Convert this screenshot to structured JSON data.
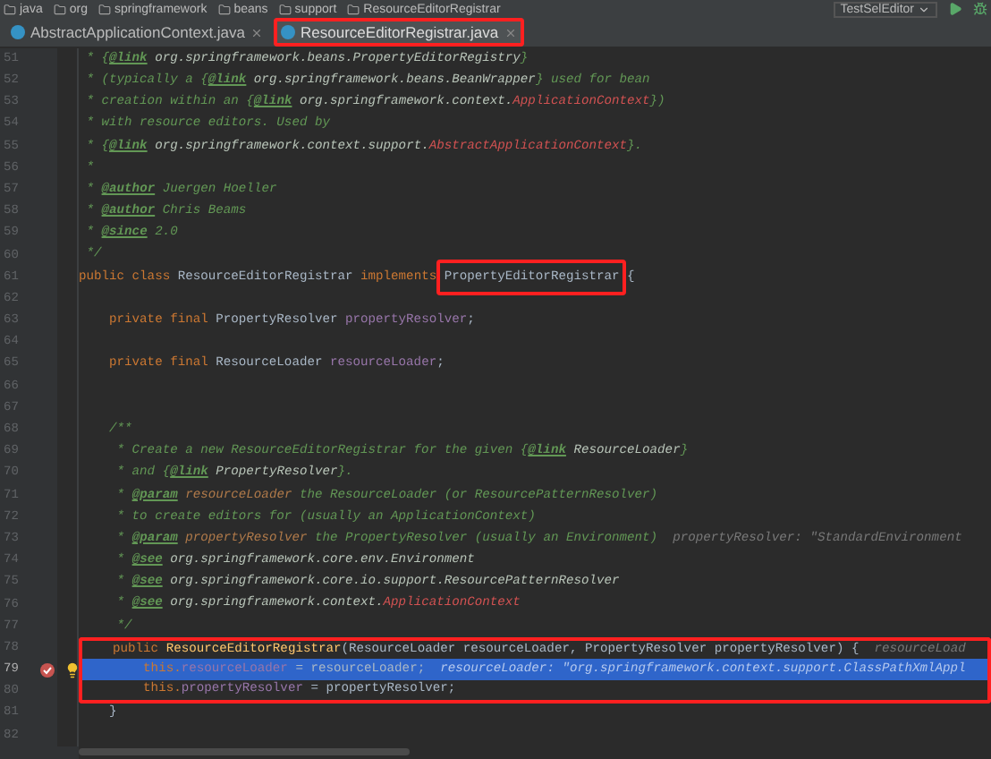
{
  "breadcrumb": {
    "items": [
      "java",
      "org",
      "springframework",
      "beans",
      "support",
      "ResourceEditorRegistrar"
    ],
    "run_config": "TestSelEditor"
  },
  "tabs": [
    {
      "label": "AbstractApplicationContext.java",
      "selected": false,
      "boxed": false
    },
    {
      "label": "ResourceEditorRegistrar.java",
      "selected": true,
      "boxed": true
    }
  ],
  "lines": [
    {
      "number": "51",
      "selected": false,
      "tokens": [
        {
          "kind": "comment",
          "text": " * {"
        },
        {
          "kind": "tag",
          "text": "@link"
        },
        {
          "kind": "ref",
          "text": " org.springframework.beans.PropertyEditorRegistry"
        },
        {
          "kind": "comment",
          "text": "}"
        }
      ]
    },
    {
      "number": "52",
      "selected": false,
      "tokens": [
        {
          "kind": "comment",
          "text": " * (typically a {"
        },
        {
          "kind": "tag",
          "text": "@link"
        },
        {
          "kind": "ref",
          "text": " org.springframework.beans.BeanWrapper"
        },
        {
          "kind": "comment",
          "text": "} used for bean"
        }
      ]
    },
    {
      "number": "53",
      "selected": false,
      "tokens": [
        {
          "kind": "comment",
          "text": " * creation within an {"
        },
        {
          "kind": "tag",
          "text": "@link"
        },
        {
          "kind": "ref",
          "text": " org.springframework.context."
        },
        {
          "kind": "red",
          "text": "ApplicationContext"
        },
        {
          "kind": "comment",
          "text": "})"
        }
      ]
    },
    {
      "number": "54",
      "selected": false,
      "tokens": [
        {
          "kind": "comment",
          "text": " * with resource editors. Used by"
        }
      ]
    },
    {
      "number": "55",
      "selected": false,
      "tokens": [
        {
          "kind": "comment",
          "text": " * {"
        },
        {
          "kind": "tag",
          "text": "@link"
        },
        {
          "kind": "ref",
          "text": " org.springframework.context.support."
        },
        {
          "kind": "red",
          "text": "AbstractApplicationContext"
        },
        {
          "kind": "comment",
          "text": "}."
        }
      ]
    },
    {
      "number": "56",
      "selected": false,
      "tokens": [
        {
          "kind": "comment",
          "text": " *"
        }
      ]
    },
    {
      "number": "57",
      "selected": false,
      "tokens": [
        {
          "kind": "comment",
          "text": " * "
        },
        {
          "kind": "tag",
          "text": "@author"
        },
        {
          "kind": "comment",
          "text": " Juergen Hoeller"
        }
      ]
    },
    {
      "number": "58",
      "selected": false,
      "tokens": [
        {
          "kind": "comment",
          "text": " * "
        },
        {
          "kind": "tag",
          "text": "@author"
        },
        {
          "kind": "comment",
          "text": " Chris Beams"
        }
      ]
    },
    {
      "number": "59",
      "selected": false,
      "tokens": [
        {
          "kind": "comment",
          "text": " * "
        },
        {
          "kind": "tag",
          "text": "@since"
        },
        {
          "kind": "comment",
          "text": " 2.0"
        }
      ]
    },
    {
      "number": "60",
      "selected": false,
      "tokens": [
        {
          "kind": "comment",
          "text": " */"
        }
      ]
    },
    {
      "number": "61",
      "selected": false,
      "tokens": [
        {
          "kind": "keyword",
          "text": "public class "
        },
        {
          "kind": "plain",
          "text": "ResourceEditorRegistrar "
        },
        {
          "kind": "keyword",
          "text": "implements "
        },
        {
          "kind": "boxed",
          "text": "PropertyEditorRegistrar"
        },
        {
          "kind": "plain",
          "text": " {"
        }
      ]
    },
    {
      "number": "62",
      "selected": false
    },
    {
      "number": "63",
      "selected": false,
      "tokens": [
        {
          "kind": "keyword",
          "text": "    private final "
        },
        {
          "kind": "plain",
          "text": "PropertyResolver "
        },
        {
          "kind": "field",
          "text": "propertyResolver"
        },
        {
          "kind": "plain",
          "text": ";"
        }
      ]
    },
    {
      "number": "64",
      "selected": false
    },
    {
      "number": "65",
      "selected": false,
      "tokens": [
        {
          "kind": "keyword",
          "text": "    private final "
        },
        {
          "kind": "plain",
          "text": "ResourceLoader "
        },
        {
          "kind": "field",
          "text": "resourceLoader"
        },
        {
          "kind": "plain",
          "text": ";"
        }
      ]
    },
    {
      "number": "66",
      "selected": false
    },
    {
      "number": "67",
      "selected": false
    },
    {
      "number": "68",
      "selected": false,
      "tokens": [
        {
          "kind": "comment",
          "text": "    /**"
        }
      ]
    },
    {
      "number": "69",
      "selected": false,
      "tokens": [
        {
          "kind": "comment",
          "text": "     * Create a new ResourceEditorRegistrar for the given {"
        },
        {
          "kind": "tag",
          "text": "@link"
        },
        {
          "kind": "ref",
          "text": " ResourceLoader"
        },
        {
          "kind": "comment",
          "text": "}"
        }
      ]
    },
    {
      "number": "70",
      "selected": false,
      "tokens": [
        {
          "kind": "comment",
          "text": "     * and {"
        },
        {
          "kind": "tag",
          "text": "@link"
        },
        {
          "kind": "ref",
          "text": " PropertyResolver"
        },
        {
          "kind": "comment",
          "text": "}."
        }
      ]
    },
    {
      "number": "71",
      "selected": false,
      "tokens": [
        {
          "kind": "comment",
          "text": "     * "
        },
        {
          "kind": "tag",
          "text": "@param"
        },
        {
          "kind": "param",
          "text": " resourceLoader"
        },
        {
          "kind": "comment",
          "text": " the ResourceLoader (or ResourcePatternResolver)"
        }
      ]
    },
    {
      "number": "72",
      "selected": false,
      "tokens": [
        {
          "kind": "comment",
          "text": "     * to create editors for (usually an ApplicationContext)"
        }
      ]
    },
    {
      "number": "73",
      "selected": false,
      "tokens": [
        {
          "kind": "comment",
          "text": "     * "
        },
        {
          "kind": "tag",
          "text": "@param"
        },
        {
          "kind": "param",
          "text": " propertyResolver"
        },
        {
          "kind": "comment",
          "text": " the PropertyResolver (usually an Environment)"
        },
        {
          "kind": "hint",
          "text": "  propertyResolver: \"StandardEnvironment"
        }
      ]
    },
    {
      "number": "74",
      "selected": false,
      "tokens": [
        {
          "kind": "comment",
          "text": "     * "
        },
        {
          "kind": "tag",
          "text": "@see"
        },
        {
          "kind": "ref",
          "text": " org.springframework.core.env.Environment"
        }
      ]
    },
    {
      "number": "75",
      "selected": false,
      "tokens": [
        {
          "kind": "comment",
          "text": "     * "
        },
        {
          "kind": "tag",
          "text": "@see"
        },
        {
          "kind": "ref",
          "text": " org.springframework.core.io.support.ResourcePatternResolver"
        }
      ]
    },
    {
      "number": "76",
      "selected": false,
      "tokens": [
        {
          "kind": "comment",
          "text": "     * "
        },
        {
          "kind": "tag",
          "text": "@see"
        },
        {
          "kind": "ref",
          "text": " org.springframework.context."
        },
        {
          "kind": "red",
          "text": "ApplicationContext"
        }
      ]
    },
    {
      "number": "77",
      "selected": false,
      "tokens": [
        {
          "kind": "comment",
          "text": "     */"
        }
      ]
    },
    {
      "number": "78",
      "boxed": true,
      "selected": false,
      "tokens": [
        {
          "kind": "keyword",
          "text": "    public "
        },
        {
          "kind": "method",
          "text": "ResourceEditorRegistrar"
        },
        {
          "kind": "plain",
          "text": "(ResourceLoader resourceLoader, PropertyResolver propertyResolver) {"
        },
        {
          "kind": "hint",
          "text": "  resourceLoad"
        }
      ]
    },
    {
      "number": "79",
      "boxed": true,
      "selected": true,
      "breakpoint": true,
      "tokens": [
        {
          "kind": "keyword",
          "text": "        this."
        },
        {
          "kind": "field",
          "text": "resourceLoader"
        },
        {
          "kind": "plain",
          "text": " = resourceLoader;"
        },
        {
          "kind": "hint",
          "text": "  resourceLoader: \"org.springframework.context.support.ClassPathXmlAppl"
        }
      ]
    },
    {
      "number": "80",
      "boxed": true,
      "selected": false,
      "tokens": [
        {
          "kind": "keyword",
          "text": "        this."
        },
        {
          "kind": "field",
          "text": "propertyResolver"
        },
        {
          "kind": "plain",
          "text": " = propertyResolver;"
        }
      ]
    },
    {
      "number": "81",
      "selected": false,
      "tokens": [
        {
          "kind": "plain",
          "text": "    }"
        }
      ]
    },
    {
      "number": "82",
      "selected": false
    }
  ]
}
